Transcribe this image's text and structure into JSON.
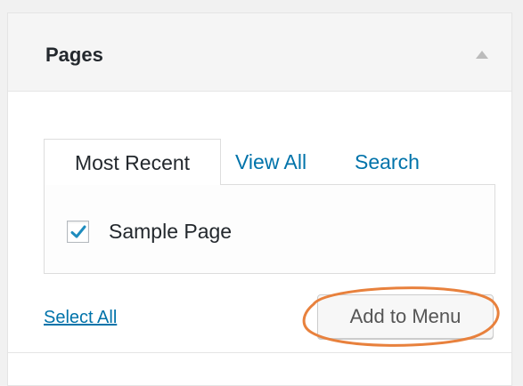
{
  "panel": {
    "title": "Pages"
  },
  "tabs": [
    {
      "label": "Most Recent",
      "active": true
    },
    {
      "label": "View All",
      "active": false
    },
    {
      "label": "Search",
      "active": false
    }
  ],
  "pages": [
    {
      "label": "Sample Page",
      "checked": true
    }
  ],
  "actions": {
    "select_all_label": "Select All",
    "add_button_label": "Add to Menu"
  },
  "colors": {
    "link": "#0073aa",
    "highlight": "#e8813d",
    "checkmark": "#1e8cbe"
  },
  "icons": {
    "collapse": "triangle-up-icon",
    "checkbox": "checkmark-icon"
  }
}
